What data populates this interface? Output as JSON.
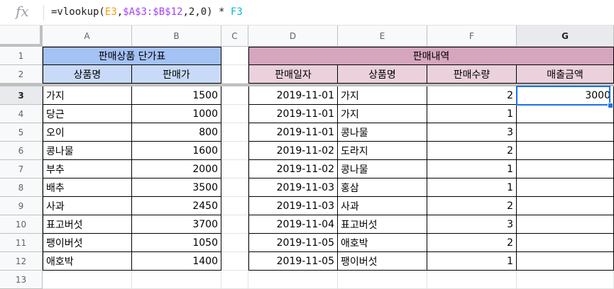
{
  "formula_bar": {
    "fx": "fx",
    "parts": [
      {
        "t": "=vlookup(",
        "c": "#202124"
      },
      {
        "t": "E3",
        "c": "#f29d0a"
      },
      {
        "t": ",",
        "c": "#202124"
      },
      {
        "t": "$A$3:$B$12",
        "c": "#a142f4"
      },
      {
        "t": ",2,0) * ",
        "c": "#202124"
      },
      {
        "t": "F3",
        "c": "#12b5cb"
      }
    ]
  },
  "columns": [
    "A",
    "B",
    "C",
    "D",
    "E",
    "F",
    "G"
  ],
  "rows": [
    "1",
    "2",
    "3",
    "4",
    "5",
    "6",
    "7",
    "8",
    "9",
    "10",
    "11",
    "12",
    "13"
  ],
  "selected": {
    "col": "G",
    "row": "3"
  },
  "colors": {
    "price_title_bg": "#a4c2f4",
    "price_header_bg": "#c9daf8",
    "sales_title_bg": "#d5a6bd",
    "sales_header_bg": "#ead1dc",
    "selection": "#1a73e8"
  },
  "price_table": {
    "title": "판매상품 단가표",
    "headers": [
      "상품명",
      "판매가"
    ],
    "rows": [
      [
        "가지",
        "1500"
      ],
      [
        "당근",
        "1000"
      ],
      [
        "오이",
        "800"
      ],
      [
        "콩나물",
        "1600"
      ],
      [
        "부추",
        "2000"
      ],
      [
        "배추",
        "3500"
      ],
      [
        "사과",
        "2450"
      ],
      [
        "표고버섯",
        "3700"
      ],
      [
        "팽이버섯",
        "1050"
      ],
      [
        "애호박",
        "1400"
      ]
    ]
  },
  "sales_table": {
    "title": "판매내역",
    "headers": [
      "판매일자",
      "상품명",
      "판매수량",
      "매출금액"
    ],
    "rows": [
      [
        "2019-11-01",
        "가지",
        "2",
        "3000"
      ],
      [
        "2019-11-01",
        "가지",
        "1",
        ""
      ],
      [
        "2019-11-01",
        "콩나물",
        "3",
        ""
      ],
      [
        "2019-11-02",
        "도라지",
        "2",
        ""
      ],
      [
        "2019-11-02",
        "콩나물",
        "1",
        ""
      ],
      [
        "2019-11-03",
        "홍삼",
        "1",
        ""
      ],
      [
        "2019-11-03",
        "사과",
        "2",
        ""
      ],
      [
        "2019-11-04",
        "표고버섯",
        "3",
        ""
      ],
      [
        "2019-11-05",
        "애호박",
        "2",
        ""
      ],
      [
        "2019-11-05",
        "팽이버섯",
        "1",
        ""
      ]
    ]
  }
}
